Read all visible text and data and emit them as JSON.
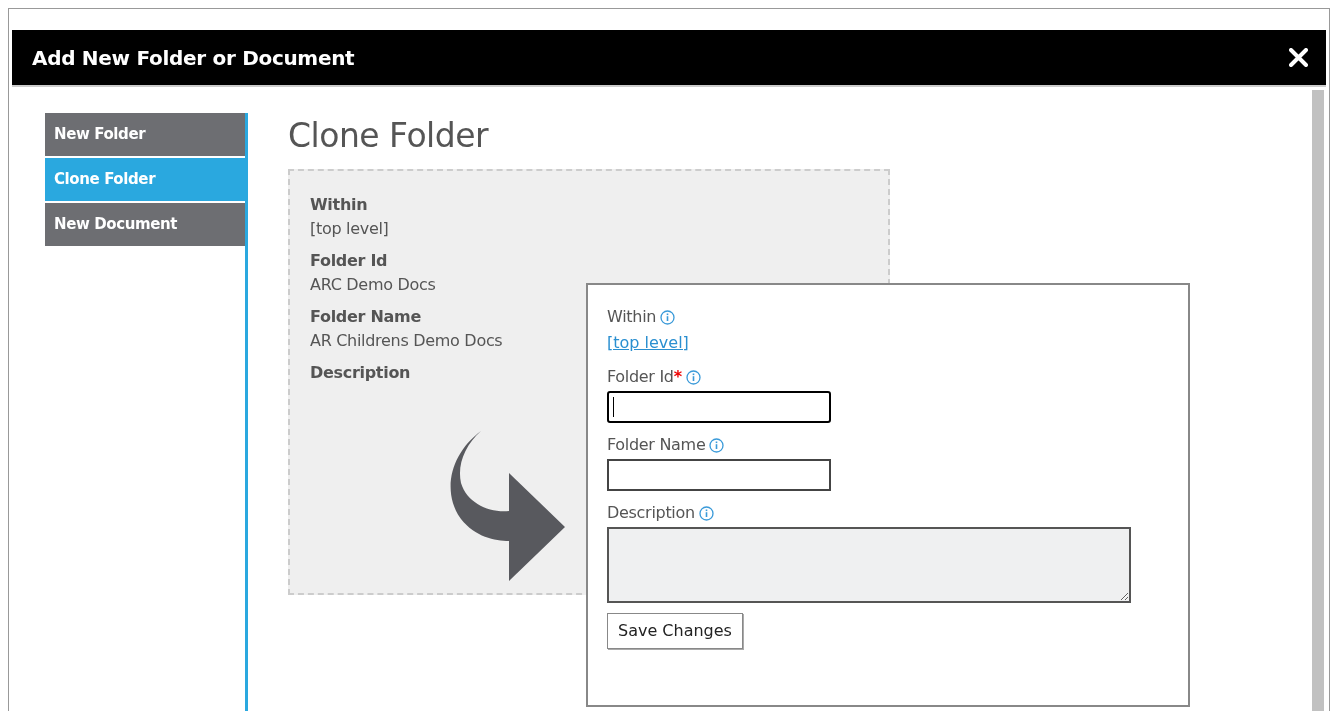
{
  "dialog": {
    "title": "Add New Folder or Document"
  },
  "sidebar": {
    "items": [
      {
        "label": "New Folder",
        "selected": false
      },
      {
        "label": "Clone Folder",
        "selected": true
      },
      {
        "label": "New Document",
        "selected": false
      }
    ]
  },
  "heading": "Clone Folder",
  "source": {
    "fields": [
      {
        "label": "Within",
        "value": "[top level]"
      },
      {
        "label": "Folder Id",
        "value": "ARC Demo Docs"
      },
      {
        "label": "Folder Name",
        "value": "AR Childrens Demo Docs"
      },
      {
        "label": "Description"
      }
    ]
  },
  "form": {
    "fields": [
      {
        "kind": "link",
        "label": "Within",
        "value": "[top level]"
      },
      {
        "kind": "input",
        "label": "Folder Id",
        "required_mark": "*",
        "focused": true
      },
      {
        "kind": "input",
        "label": "Folder Name",
        "focused": false
      },
      {
        "kind": "textarea",
        "label": "Description"
      }
    ],
    "button": "Save Changes"
  }
}
